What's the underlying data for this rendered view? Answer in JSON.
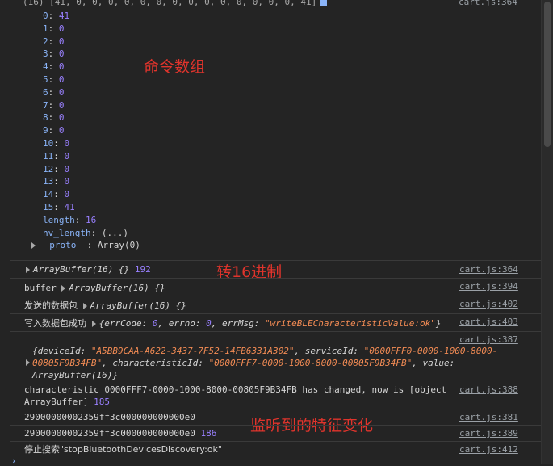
{
  "top": {
    "text": "(16) [41, 0, 0, 0, 0, 0, 0, 0, 0, 0, 0, 0, 0, 0, 0, 41]",
    "source": "cart.js:364"
  },
  "array_items": [
    {
      "key": "0",
      "val": "41"
    },
    {
      "key": "1",
      "val": "0"
    },
    {
      "key": "2",
      "val": "0"
    },
    {
      "key": "3",
      "val": "0"
    },
    {
      "key": "4",
      "val": "0"
    },
    {
      "key": "5",
      "val": "0"
    },
    {
      "key": "6",
      "val": "0"
    },
    {
      "key": "7",
      "val": "0"
    },
    {
      "key": "8",
      "val": "0"
    },
    {
      "key": "9",
      "val": "0"
    },
    {
      "key": "10",
      "val": "0"
    },
    {
      "key": "11",
      "val": "0"
    },
    {
      "key": "12",
      "val": "0"
    },
    {
      "key": "13",
      "val": "0"
    },
    {
      "key": "14",
      "val": "0"
    },
    {
      "key": "15",
      "val": "41"
    }
  ],
  "length_row": {
    "key": "length",
    "val": "16"
  },
  "nv_length_row": {
    "key": "nv_length",
    "val": "(...)"
  },
  "proto_row": {
    "key": "__proto__",
    "val": "Array(0)"
  },
  "annotations": {
    "a1": "命令数组",
    "a2": "转16进制",
    "a3": "监听到的特征变化"
  },
  "logs": [
    {
      "prefix": "",
      "obj": "ArrayBuffer(16) {}",
      "suffix": "192",
      "source": "cart.js:364"
    },
    {
      "prefix": "buffer",
      "obj": "ArrayBuffer(16) {}",
      "suffix": "",
      "source": "cart.js:394"
    },
    {
      "prefix": "发送的数据包",
      "obj": "ArrayBuffer(16) {}",
      "suffix": "",
      "source": "cart.js:402"
    },
    {
      "prefix": "写入数据包成功",
      "obj": "{errCode: 0, errno: 0, errMsg: \"writeBLECharacteristicValue:ok\"}",
      "suffix": "",
      "source": "cart.js:403"
    },
    {
      "prefix": "",
      "obj": "{deviceId: \"A5BB9CAA-A622-3437-7F52-14FB6331A302\", serviceId: \"0000FFF0-0000-1000-8000-00805F9B34FB\", characteristicId: \"0000FFF7-0000-1000-8000-00805F9B34FB\", value: ArrayBuffer(16)}",
      "suffix": "",
      "source": "cart.js:387"
    },
    {
      "prefix": "characteristic 0000FFF7-0000-1000-8000-00805F9B34FB has changed, now is [object ArrayBuffer]",
      "obj": "",
      "suffix": "185",
      "source": "cart.js:388"
    },
    {
      "prefix": "29000000002359ff3c000000000000e0",
      "obj": "",
      "suffix": "",
      "source": "cart.js:381"
    },
    {
      "prefix": "29000000002359ff3c000000000000e0",
      "obj": "",
      "suffix": "186",
      "source": "cart.js:389"
    },
    {
      "prefix": "停止搜索\"stopBluetoothDevicesDiscovery:ok\"",
      "obj": "",
      "suffix": "",
      "source": "cart.js:412"
    }
  ],
  "colors": {
    "background": "#242424",
    "annotation": "#e0342c",
    "key": "#8ab4f8",
    "number": "#9980ff",
    "string": "#f28b54"
  }
}
